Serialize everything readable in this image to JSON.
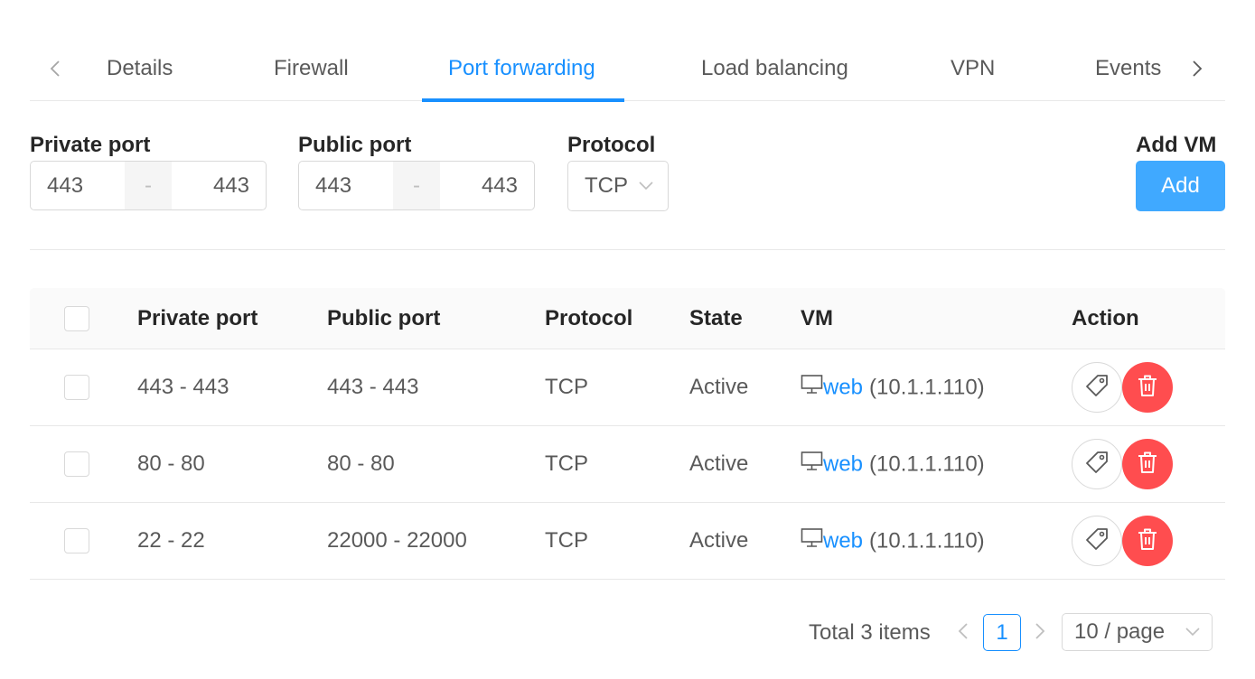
{
  "tabs": {
    "items": [
      "Details",
      "Firewall",
      "Port forwarding",
      "Load balancing",
      "VPN",
      "Events"
    ],
    "active": "Port forwarding",
    "prev_icon": "chevron-left-icon",
    "next_icon": "chevron-right-icon"
  },
  "form": {
    "private_port": {
      "label": "Private port",
      "start": "443",
      "separator": "-",
      "end": "443"
    },
    "public_port": {
      "label": "Public port",
      "start": "443",
      "separator": "-",
      "end": "443"
    },
    "protocol": {
      "label": "Protocol",
      "value": "TCP"
    },
    "add_vm": {
      "label": "Add VM",
      "button": "Add"
    }
  },
  "table": {
    "columns": [
      "Private port",
      "Public port",
      "Protocol",
      "State",
      "VM",
      "Action"
    ],
    "rows": [
      {
        "private_port": "443 - 443",
        "public_port": "443 - 443",
        "protocol": "TCP",
        "state": "Active",
        "vm_name": "web",
        "vm_ip": "(10.1.1.110)"
      },
      {
        "private_port": "80 - 80",
        "public_port": "80 - 80",
        "protocol": "TCP",
        "state": "Active",
        "vm_name": "web",
        "vm_ip": "(10.1.1.110)"
      },
      {
        "private_port": "22 - 22",
        "public_port": "22000 - 22000",
        "protocol": "TCP",
        "state": "Active",
        "vm_name": "web",
        "vm_ip": "(10.1.1.110)"
      }
    ],
    "action_icons": [
      "tag-icon",
      "delete-icon"
    ]
  },
  "pagination": {
    "total": "Total 3 items",
    "current_page": "1",
    "page_size": "10 / page"
  },
  "colors": {
    "accent": "#1890ff",
    "primary_button": "#40a9ff",
    "danger": "#ff4d4f"
  }
}
